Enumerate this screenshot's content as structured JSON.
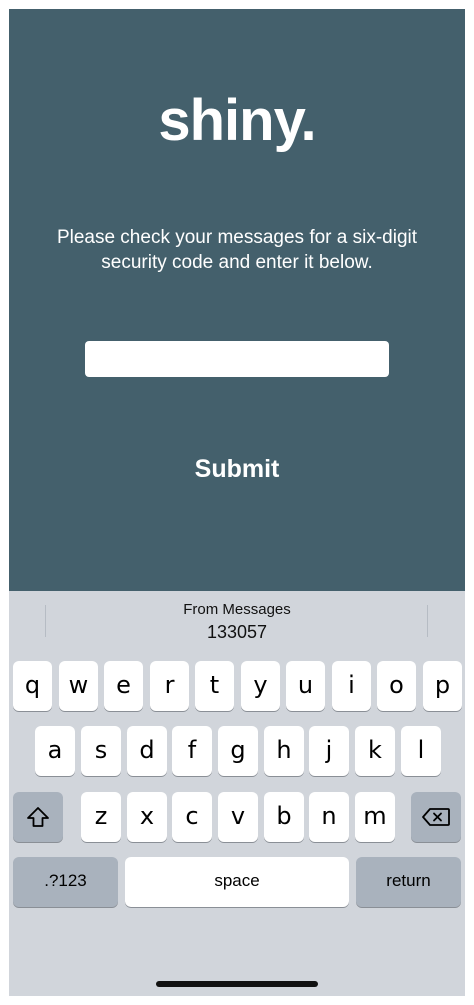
{
  "app": {
    "logo": "shiny.",
    "instructions": "Please check your messages for a six-digit security code and enter it below.",
    "code_input_value": "",
    "submit_label": "Submit",
    "colors": {
      "background": "#44606c",
      "text": "#ffffff"
    }
  },
  "keyboard": {
    "suggestion": {
      "title": "From Messages",
      "code": "133057"
    },
    "rows": [
      [
        "q",
        "w",
        "e",
        "r",
        "t",
        "y",
        "u",
        "i",
        "o",
        "p"
      ],
      [
        "a",
        "s",
        "d",
        "f",
        "g",
        "h",
        "j",
        "k",
        "l"
      ],
      [
        "z",
        "x",
        "c",
        "v",
        "b",
        "n",
        "m"
      ]
    ],
    "numbers_label": ".?123",
    "space_label": "space",
    "return_label": "return",
    "shift_icon": "shift-icon",
    "delete_icon": "delete-icon"
  }
}
